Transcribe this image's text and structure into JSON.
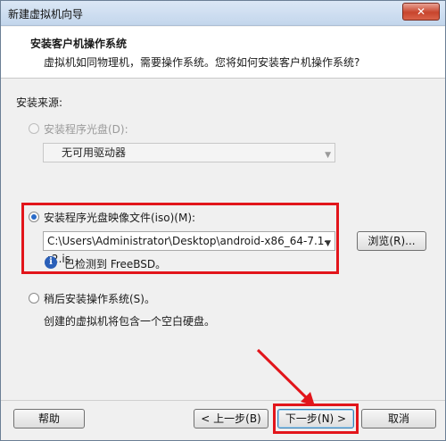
{
  "window": {
    "title": "新建虚拟机向导",
    "close_glyph": "✕"
  },
  "header": {
    "title": "安装客户机操作系统",
    "subtitle": "虚拟机如同物理机，需要操作系统。您将如何安装客户机操作系统?"
  },
  "source": {
    "label": "安装来源:",
    "disc": {
      "label": "安装程序光盘(D):",
      "selected": false,
      "enabled": false,
      "combo_value": "无可用驱动器"
    },
    "iso": {
      "label": "安装程序光盘映像文件(iso)(M):",
      "selected": true,
      "path": "C:\\Users\\Administrator\\Desktop\\android-x86_64-7.1-r2.is",
      "browse_label": "浏览(R)...",
      "detected": "已检测到 FreeBSD。"
    },
    "later": {
      "label": "稍后安装操作系统(S)。",
      "selected": false,
      "description": "创建的虚拟机将包含一个空白硬盘。"
    }
  },
  "footer": {
    "help_label": "帮助",
    "back_label": "< 上一步(B)",
    "next_label": "下一步(N) >",
    "cancel_label": "取消"
  },
  "icons": {
    "info": "info-icon",
    "dropdown": "chevron-down-icon",
    "close": "close-icon",
    "annotation_arrow": "red-arrow-icon"
  },
  "colors": {
    "highlight_red": "#e2151b",
    "radio_selected": "#2a6bc8",
    "info_blue": "#2a5fb8"
  }
}
